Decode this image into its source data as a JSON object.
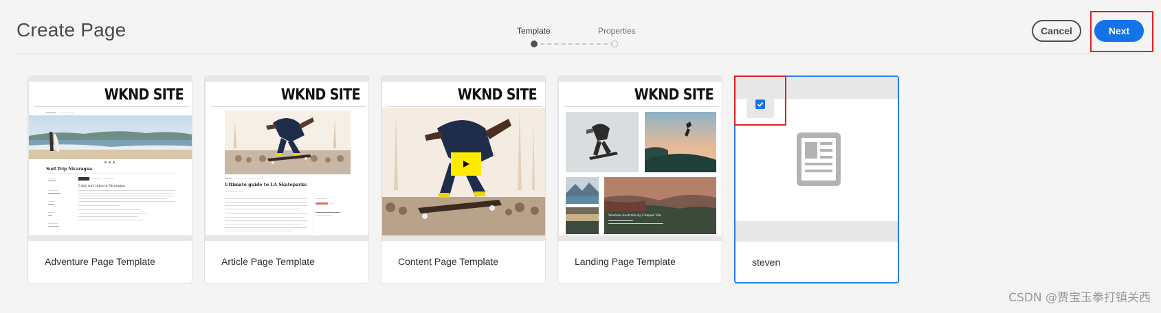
{
  "header": {
    "title": "Create Page",
    "steps": [
      {
        "label": "Template",
        "state": "current"
      },
      {
        "label": "Properties",
        "state": "upcoming"
      }
    ],
    "cancel_label": "Cancel",
    "next_label": "Next"
  },
  "templates": [
    {
      "label": "Adventure Page Template",
      "thumb_brand": "WKND SITE",
      "thumb_heading": "Surf Trip Nicaragua",
      "thumb_subheading": "5 day surf camp in Nicaragua",
      "selected": false
    },
    {
      "label": "Article Page Template",
      "thumb_brand": "WKND SITE",
      "thumb_heading": "Ultimate guide to LA Skateparks",
      "selected": false
    },
    {
      "label": "Content Page Template",
      "thumb_brand": "WKND SITE",
      "selected": false
    },
    {
      "label": "Landing Page Template",
      "thumb_brand": "WKND SITE",
      "thumb_caption": "Western Australia by Camper Van",
      "selected": false
    },
    {
      "label": "steven",
      "selected": true
    }
  ],
  "colors": {
    "accent": "#1473e6",
    "selected_border": "#2680eb",
    "highlight": "#e02020",
    "background": "#f4f4f4"
  },
  "watermark": "CSDN @贾宝玉拳打镇关西"
}
